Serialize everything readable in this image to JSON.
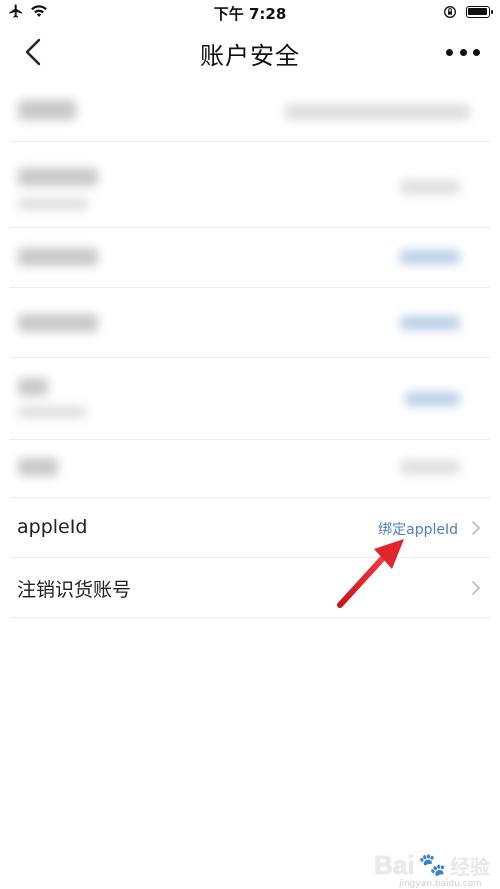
{
  "status_bar": {
    "time": "下午 7:28",
    "icons": [
      "airplane-icon",
      "wifi-icon",
      "rotation-lock-icon",
      "battery-icon"
    ]
  },
  "nav": {
    "title": "账户安全",
    "back_icon": "chevron-left-icon",
    "more_icon": "more-dots-icon"
  },
  "items": [
    {
      "label": "appleId",
      "value": "绑定appleId"
    },
    {
      "label": "注销识货账号",
      "value": ""
    }
  ],
  "watermark": {
    "logo": "Bai",
    "text": "经验",
    "sub": "jingyan.baidu.com"
  },
  "colors": {
    "link": "#4d7fbf",
    "arrow": "#e0262b",
    "divider": "#ececec"
  }
}
